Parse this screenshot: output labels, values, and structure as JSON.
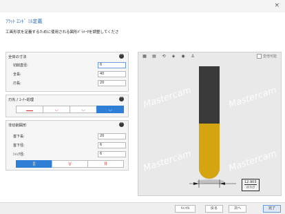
{
  "window": {
    "close_glyph": "×"
  },
  "dialog": {
    "title": "ﾌﾗｯﾄ ｴﾝﾄﾞ ﾐﾙ定義",
    "instruction": "工具形状を定義するために使用される図形ﾊﾟﾗﾒｰﾀを調整してくださ"
  },
  "overall": {
    "header": "全体の寸法",
    "rows": [
      {
        "label": "切削直径:",
        "value": "6"
      },
      {
        "label": "全長:",
        "value": "40"
      },
      {
        "label": "刃長:",
        "value": "20"
      }
    ]
  },
  "corner": {
    "header": "刃先 / ｺｰﾅｰ処理",
    "options": [
      "",
      "◡",
      "◡",
      "◡"
    ],
    "selected_index": 3
  },
  "noncut": {
    "header": "非切削図形",
    "rows": [
      {
        "label": "首下長:",
        "value": "20"
      },
      {
        "label": "首下径:",
        "value": "6"
      },
      {
        "label": "ｼｬﾝｸ径:",
        "value": "6"
      }
    ],
    "options": [
      "||",
      "\\/",
      ")("
    ],
    "selected_index": 0
  },
  "preview": {
    "toolbar_icons": [
      "fit-icon",
      "zoom-fit-icon",
      "rotate-icon",
      "view-icon",
      "shade-icon",
      "light-icon"
    ],
    "checkbox_label": "変倍可能",
    "watermark": "Mastercam",
    "dimension_value": "12.903",
    "dimension_unit": "ﾒﾄﾘｯｸ",
    "colors": {
      "tool_shank": "#3a3a3a",
      "tool_flute": "#d4a510"
    }
  },
  "footer": {
    "cancel": "ｷｬﾝｾﾙ",
    "back": "戻る",
    "next": "次へ",
    "finish": "完了"
  }
}
